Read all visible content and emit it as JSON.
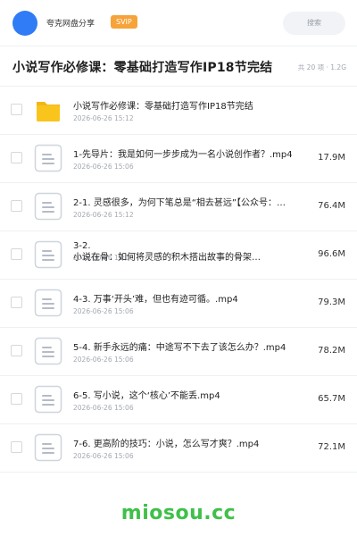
{
  "header": {
    "share_name": "夸克网盘分享",
    "badge": "SVIP",
    "search_placeholder": "搜索"
  },
  "title": "小说写作必修课：零基础打造写作IP18节完结",
  "meta": "共 20 项 · 1.2G",
  "files": [
    {
      "name": "小说写作必修课：零基础打造写作IP18节完结",
      "date": "2026-06-26 15:12",
      "size": "",
      "type": "folder-icon"
    },
    {
      "name": "1-先导片：我是如何一步步成为一名小说创作者？.mp4",
      "date": "2026-06-26 15:06",
      "size": "17.9M",
      "type": "doc-icon"
    },
    {
      "name": "2-1. 灵感很多，为何下笔总是“相去甚远”【公众号：…",
      "date": "2026-06-26 15:12",
      "size": "76.4M",
      "type": "doc-icon"
    },
    {
      "name": "3-2.\n小说在骨：如何将灵感的积木搭出故事的骨架…",
      "date": "2026-06-26 15:06",
      "size": "96.6M",
      "type": "doc-icon"
    },
    {
      "name": "4-3. 万事‘开头’难，但也有迹可循。.mp4",
      "date": "2026-06-26 15:06",
      "size": "79.3M",
      "type": "doc-icon"
    },
    {
      "name": "5-4. 新手永远的痛：中途写不下去了该怎么办？.mp4",
      "date": "2026-06-26 15:06",
      "size": "78.2M",
      "type": "doc-icon"
    },
    {
      "name": "6-5. 写小说，这个‘核心’不能丢.mp4",
      "date": "2026-06-26 15:06",
      "size": "65.7M",
      "type": "doc-icon"
    },
    {
      "name": "7-6. 更高阶的技巧：小说，怎么写才爽？.mp4",
      "date": "2026-06-26 15:06",
      "size": "72.1M",
      "type": "doc-icon"
    }
  ],
  "watermark": "miosou.cc",
  "colors": {
    "accent": "#2f7cf6",
    "svip": "#f6a33a",
    "folder": "#f9c51c",
    "watermark": "#3fc04a"
  }
}
